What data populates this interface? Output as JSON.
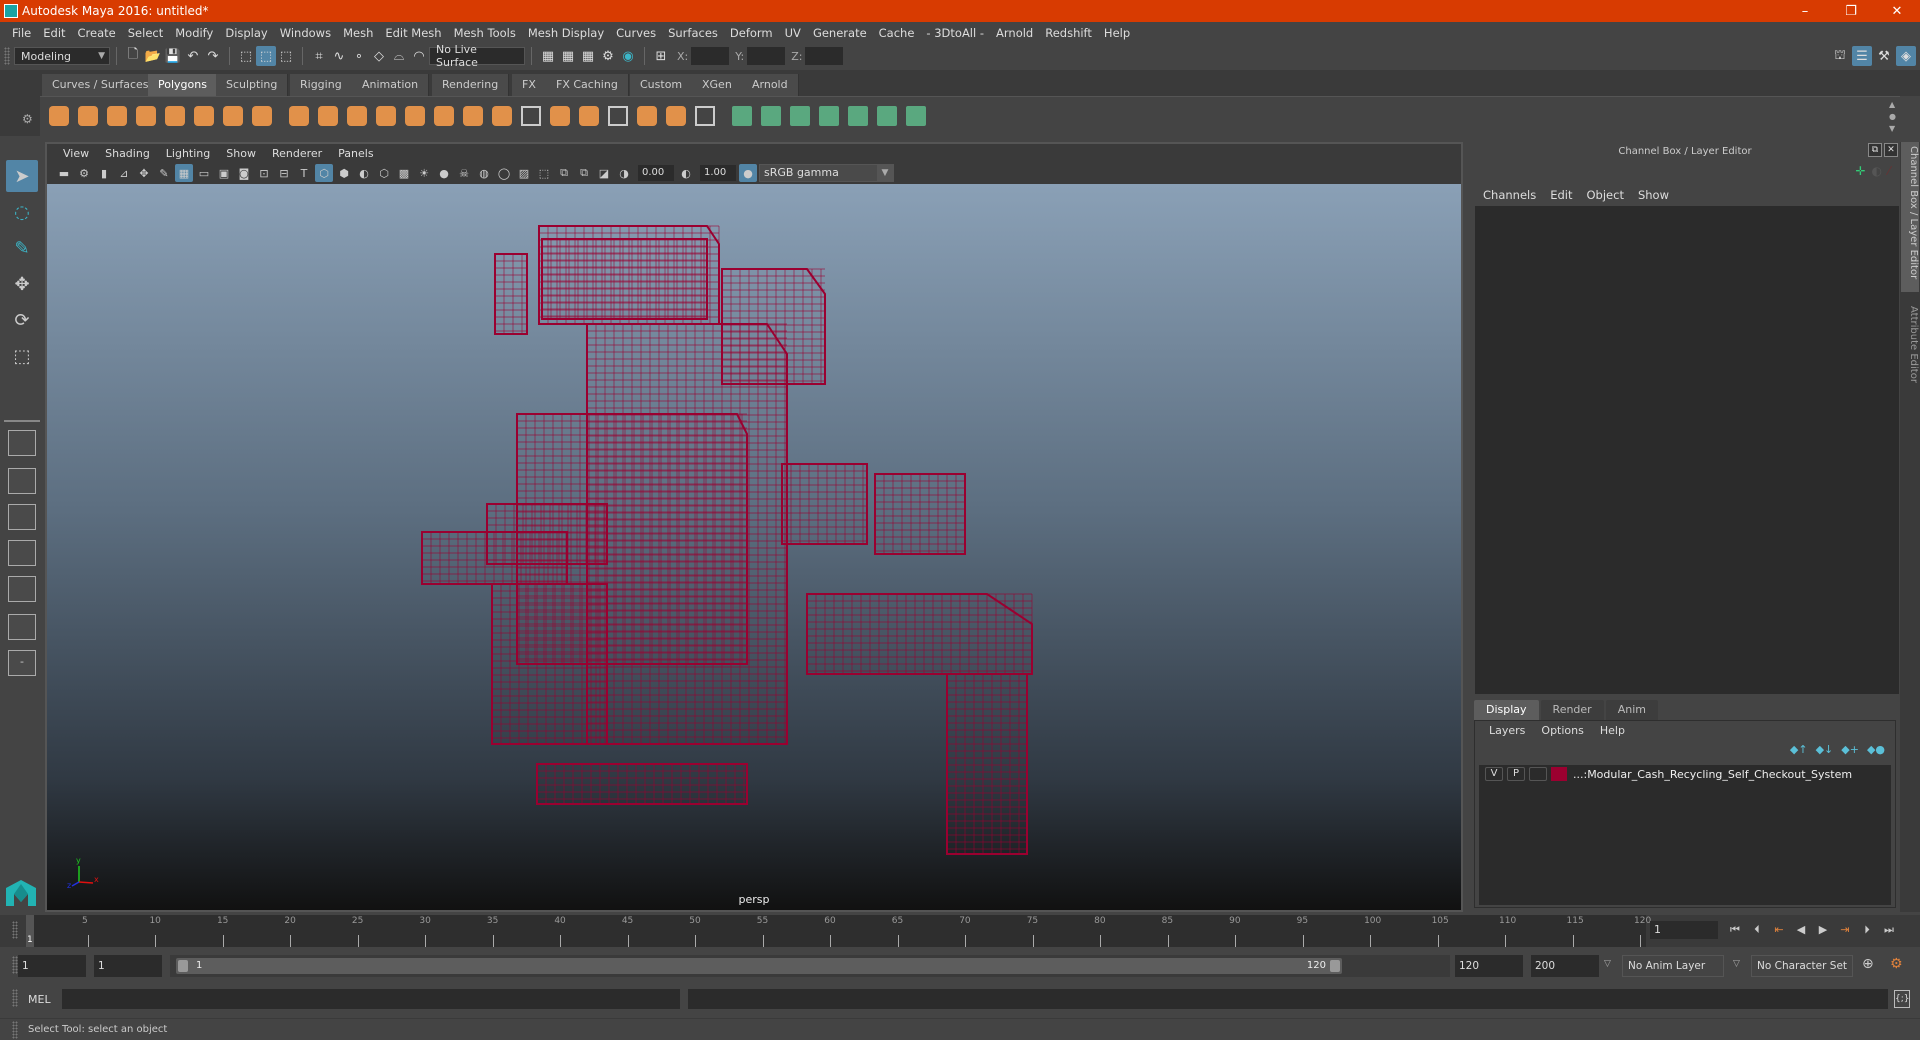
{
  "window": {
    "title": "Autodesk Maya 2016: untitled*",
    "controls": {
      "minimize": "–",
      "restore": "❐",
      "close": "✕"
    }
  },
  "menubar": {
    "items": [
      "File",
      "Edit",
      "Create",
      "Select",
      "Modify",
      "Display",
      "Windows",
      "Mesh",
      "Edit Mesh",
      "Mesh Tools",
      "Mesh Display",
      "Curves",
      "Surfaces",
      "Deform",
      "UV",
      "Generate",
      "Cache",
      "- 3DtoAll -",
      "Arnold",
      "Redshift",
      "Help"
    ]
  },
  "toolbar": {
    "mode_select": "Modeling",
    "live_surface": "No Live Surface",
    "xyz_labels": {
      "x": "X:",
      "y": "Y:",
      "z": "Z:"
    },
    "xyz_values": {
      "x": "",
      "y": "",
      "z": ""
    }
  },
  "shelf": {
    "tabs": [
      "Curves / Surfaces",
      "Polygons",
      "Sculpting",
      "Rigging",
      "Animation",
      "Rendering",
      "FX",
      "FX Caching",
      "Custom",
      "XGen",
      "Arnold"
    ],
    "active_tab": "Polygons",
    "icons": [
      "poly-sphere-icon",
      "poly-cube-icon",
      "poly-cylinder-icon",
      "poly-cone-icon",
      "poly-plane-icon",
      "poly-torus-icon",
      "poly-pyramid-icon",
      "poly-pipe-icon",
      "combine-icon",
      "separate-icon",
      "mirror-icon",
      "smooth-icon",
      "extract-icon",
      "booleans-icon",
      "multi-cut-icon",
      "extrude-icon",
      "bridge-icon",
      "bevel-icon",
      "insert-edgeloop-icon",
      "append-polygon-icon",
      "fill-hole-icon",
      "merge-icon",
      "target-weld-icon",
      "uv-planar-icon",
      "uv-cylindrical-icon",
      "uv-spherical-icon",
      "uv-automatic-icon",
      "uv-unfold-icon",
      "uv-editor-icon",
      "uv-layout-icon"
    ]
  },
  "viewport": {
    "menu": [
      "View",
      "Shading",
      "Lighting",
      "Show",
      "Renderer",
      "Panels"
    ],
    "exposure": "0.00",
    "gamma": "1.00",
    "color_space": "sRGB gamma",
    "camera_label": "persp",
    "axis": {
      "x": "x",
      "y": "y",
      "z": "z"
    },
    "wire_color": "#9b0030"
  },
  "channel_box": {
    "header": "Channel Box / Layer Editor",
    "menu": [
      "Channels",
      "Edit",
      "Object",
      "Show"
    ]
  },
  "layer_editor": {
    "tabs": [
      "Display",
      "Render",
      "Anim"
    ],
    "active_tab": "Display",
    "menu": [
      "Layers",
      "Options",
      "Help"
    ],
    "layers": [
      {
        "visible": "V",
        "playback": "P",
        "reference": "",
        "color": "#9b0030",
        "name": "...:Modular_Cash_Recycling_Self_Checkout_System"
      }
    ]
  },
  "side_tabs": [
    "Channel Box / Layer Editor",
    "Attribute Editor"
  ],
  "timeline": {
    "ticks": [
      5,
      10,
      15,
      20,
      25,
      30,
      35,
      40,
      45,
      50,
      55,
      60,
      65,
      70,
      75,
      80,
      85,
      90,
      95,
      100,
      105,
      110,
      115,
      120
    ],
    "start": 1,
    "end": 120,
    "current_frame": "1",
    "current_frame_field": "1"
  },
  "range": {
    "start_field": "1",
    "playback_start_field": "1",
    "slider_start": "1",
    "slider_end": "120",
    "playback_end_field": "120",
    "end_field": "200",
    "anim_layer": "No Anim Layer",
    "character_set": "No Character Set"
  },
  "command_line": {
    "label": "MEL",
    "input": "",
    "output": ""
  },
  "status": {
    "help_line": "Select Tool: select an object"
  }
}
